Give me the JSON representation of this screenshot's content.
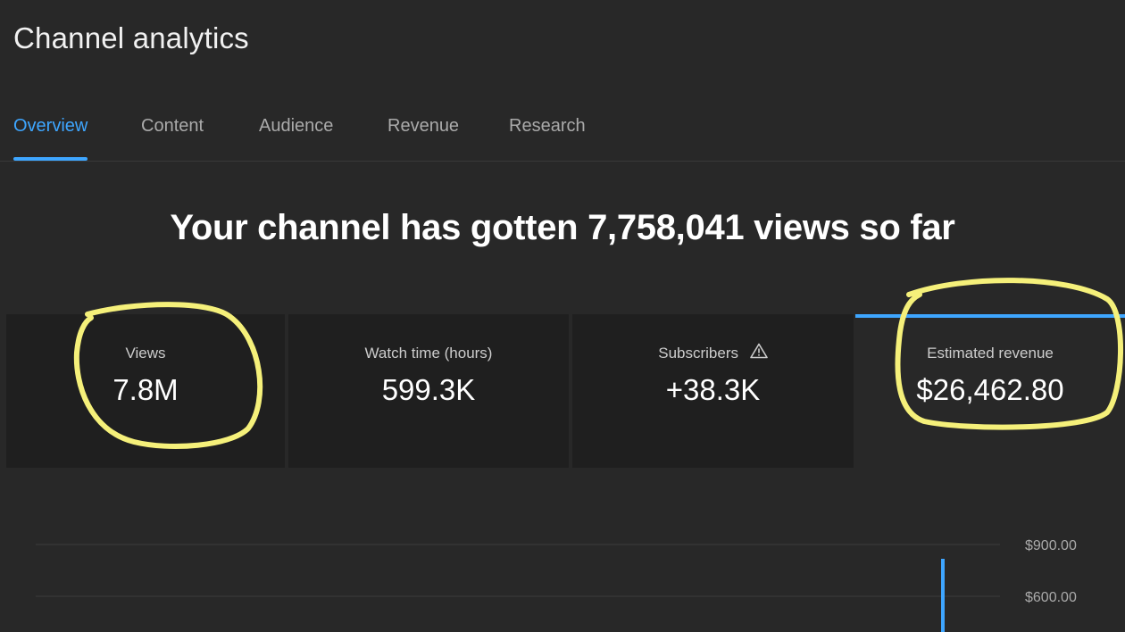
{
  "header": {
    "title": "Channel analytics"
  },
  "tabs": [
    {
      "label": "Overview",
      "active": true
    },
    {
      "label": "Content",
      "active": false
    },
    {
      "label": "Audience",
      "active": false
    },
    {
      "label": "Revenue",
      "active": false
    },
    {
      "label": "Research",
      "active": false
    }
  ],
  "headline": "Your channel has gotten 7,758,041 views so far",
  "metrics": [
    {
      "label": "Views",
      "value": "7.8M"
    },
    {
      "label": "Watch time (hours)",
      "value": "599.3K"
    },
    {
      "label": "Subscribers",
      "value": "+38.3K",
      "icon": "warning-icon"
    },
    {
      "label": "Estimated revenue",
      "value": "$26,462.80",
      "selected": true
    }
  ],
  "colors": {
    "accent": "#3ea6ff",
    "background": "#282828",
    "card": "#1f1f1f",
    "highlight_marker": "#f5f07a"
  },
  "chart_data": {
    "type": "line",
    "y_axis_ticks": [
      "$900.00",
      "$600.00"
    ],
    "y_tick_values": [
      900,
      600
    ],
    "series": [
      {
        "values": [
          900
        ]
      }
    ]
  }
}
